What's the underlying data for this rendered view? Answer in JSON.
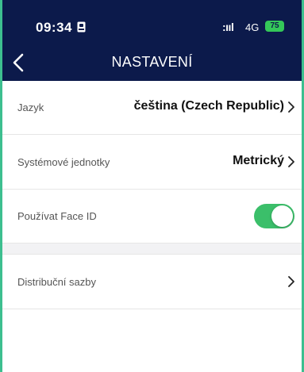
{
  "status_bar": {
    "time": "09:34",
    "signal": ":ııl",
    "network": "4G",
    "battery": "75"
  },
  "nav": {
    "title": "NASTAVENÍ"
  },
  "settings": {
    "language": {
      "label": "Jazyk",
      "value": "čeština (Czech Republic)"
    },
    "units": {
      "label": "Systémové jednotky",
      "value": "Metrický"
    },
    "face_id": {
      "label": "Používat Face ID",
      "enabled": true
    },
    "distribution": {
      "label": "Distribuční sazby"
    }
  },
  "colors": {
    "header_bg": "#0c1a4b",
    "toggle_on": "#3bbf6a",
    "frame_accent": "#3dbf8f"
  }
}
